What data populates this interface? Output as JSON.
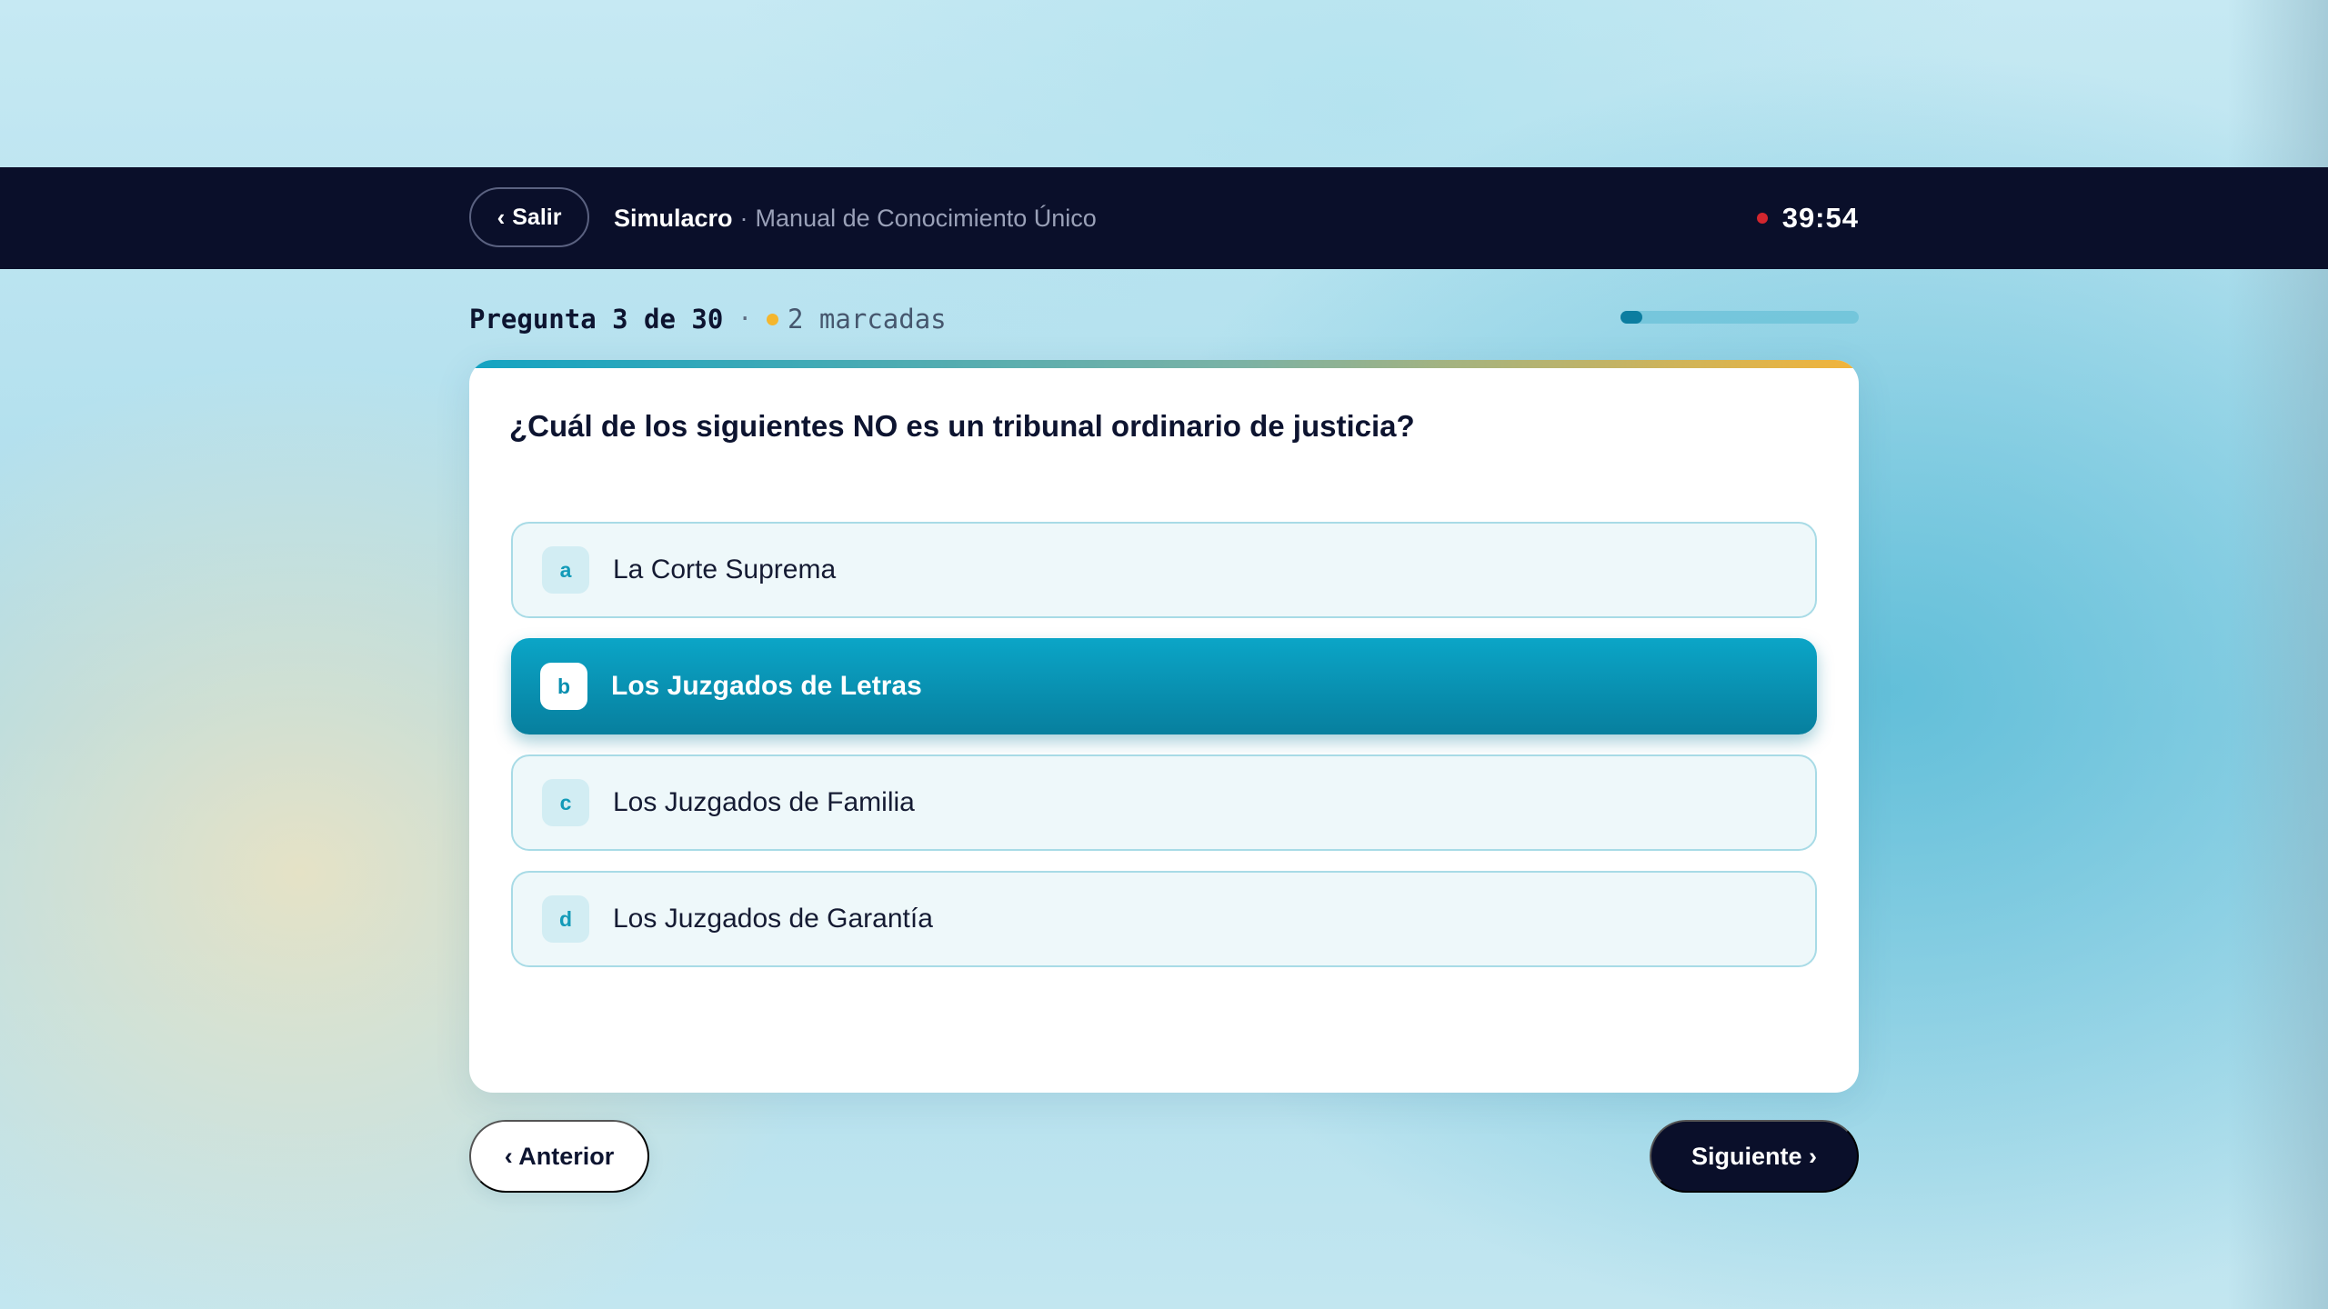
{
  "header": {
    "exit_icon": "chevron-left-icon",
    "exit_label": "Salir",
    "title": "Simulacro",
    "separator": "·",
    "subtitle": "Manual de Conocimiento Único",
    "timer": "39:54",
    "timer_dot_color": "#d2262e"
  },
  "progress": {
    "counter_text": "Pregunta 3 de 30",
    "separator": "·",
    "marked_text": "2 marcadas",
    "marked_dot_color": "#f4b62d",
    "current": 3,
    "total": 30
  },
  "question": {
    "text": "¿Cuál de los siguientes NO es un tribunal ordinario de justicia?",
    "options": [
      {
        "letter": "a",
        "label": "La Corte Suprema",
        "selected": false
      },
      {
        "letter": "b",
        "label": "Los Juzgados de Letras",
        "selected": true
      },
      {
        "letter": "c",
        "label": "Los Juzgados de Familia",
        "selected": false
      },
      {
        "letter": "d",
        "label": "Los Juzgados de Garantía",
        "selected": false
      }
    ]
  },
  "nav": {
    "prev_label": "‹ Anterior",
    "next_label": "Siguiente ›"
  },
  "colors": {
    "accent": "#0ba5c7",
    "dark": "#0a0f2a",
    "marked": "#f4b62d"
  }
}
